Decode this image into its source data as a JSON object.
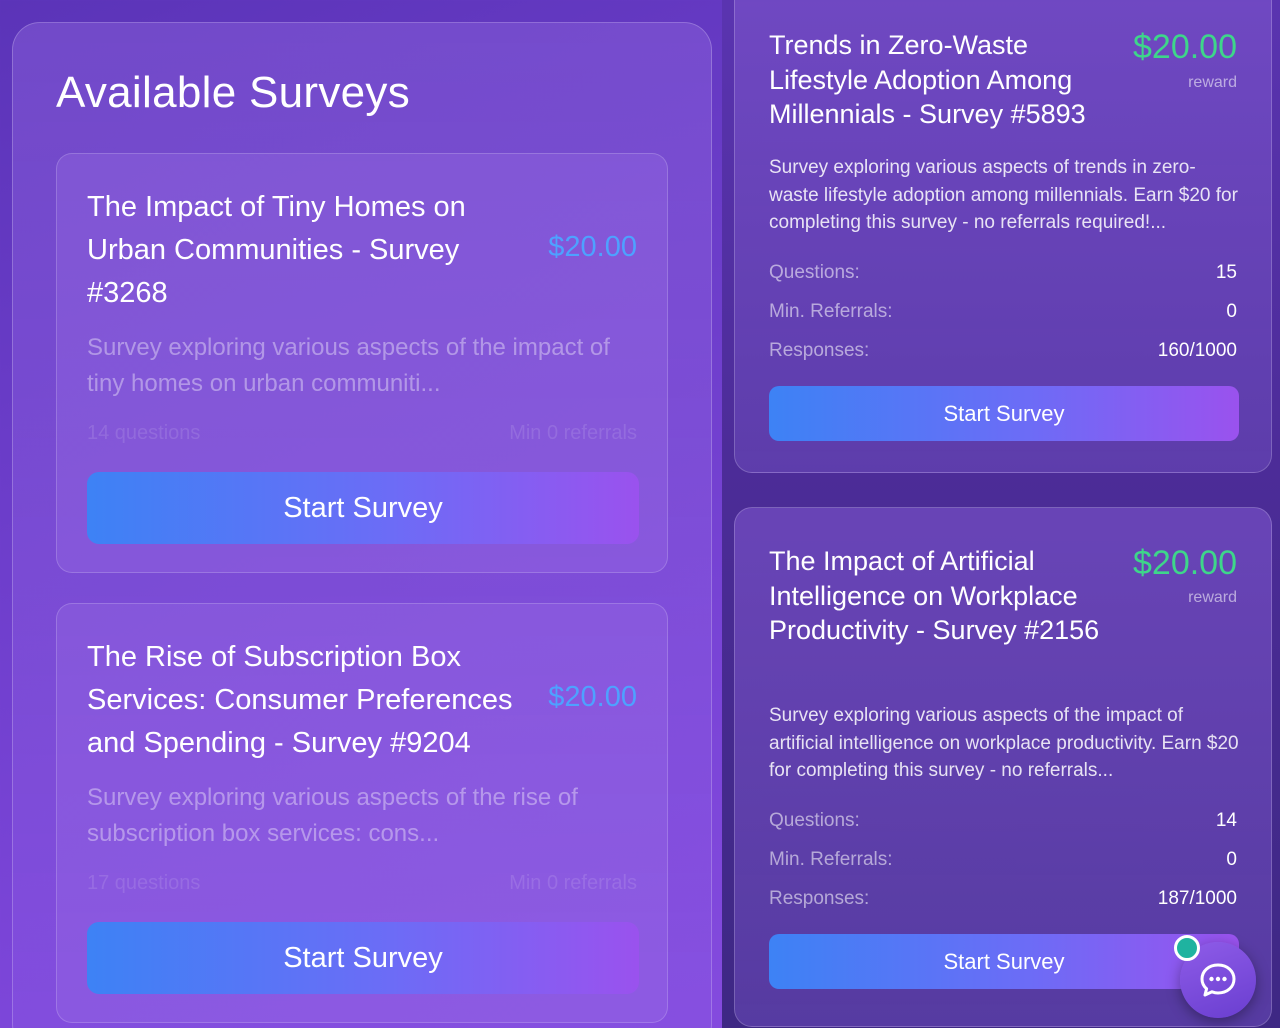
{
  "panel": {
    "title": "Available Surveys"
  },
  "left_cards": [
    {
      "title": "The Impact of Tiny Homes on Urban Communities - Survey #3268",
      "price": "$20.00",
      "description": "Survey exploring various aspects of the impact of tiny homes on urban communiti...",
      "questions": "14 questions",
      "referrals": "Min 0 referrals",
      "button": "Start Survey"
    },
    {
      "title": "The Rise of Subscription Box Services: Consumer Preferences and Spending - Survey #9204",
      "price": "$20.00",
      "description": "Survey exploring various aspects of the rise of subscription box services: cons...",
      "questions": "17 questions",
      "referrals": "Min 0 referrals",
      "button": "Start Survey"
    }
  ],
  "right_cards": [
    {
      "title": "Trends in Zero-Waste Lifestyle Adoption Among Millennials - Survey #5893",
      "price": "$20.00",
      "reward_label": "reward",
      "description": "Survey exploring various aspects of trends in zero-waste lifestyle adoption among millennials. Earn $20 for completing this survey - no referrals required!...",
      "questions_label": "Questions:",
      "questions": "15",
      "referrals_label": "Min. Referrals:",
      "referrals": "0",
      "responses_label": "Responses:",
      "responses": "160/1000",
      "button": "Start Survey"
    },
    {
      "title": "The Impact of Artificial Intelligence on Workplace Productivity - Survey #2156",
      "price": "$20.00",
      "reward_label": "reward",
      "description": "Survey exploring various aspects of the impact of artificial intelligence on workplace productivity. Earn $20 for completing this survey - no referrals...",
      "questions_label": "Questions:",
      "questions": "14",
      "referrals_label": "Min. Referrals:",
      "referrals": "0",
      "responses_label": "Responses:",
      "responses": "187/1000",
      "button": "Start Survey"
    }
  ],
  "chat": {
    "icon": "chat-bubble-icon",
    "status_color": "#1fb3a0"
  },
  "colors": {
    "price_blue": "#4ea1ff",
    "price_green": "#3ed68a",
    "button_start": "#3d82f5",
    "button_end": "#9a52ee"
  }
}
